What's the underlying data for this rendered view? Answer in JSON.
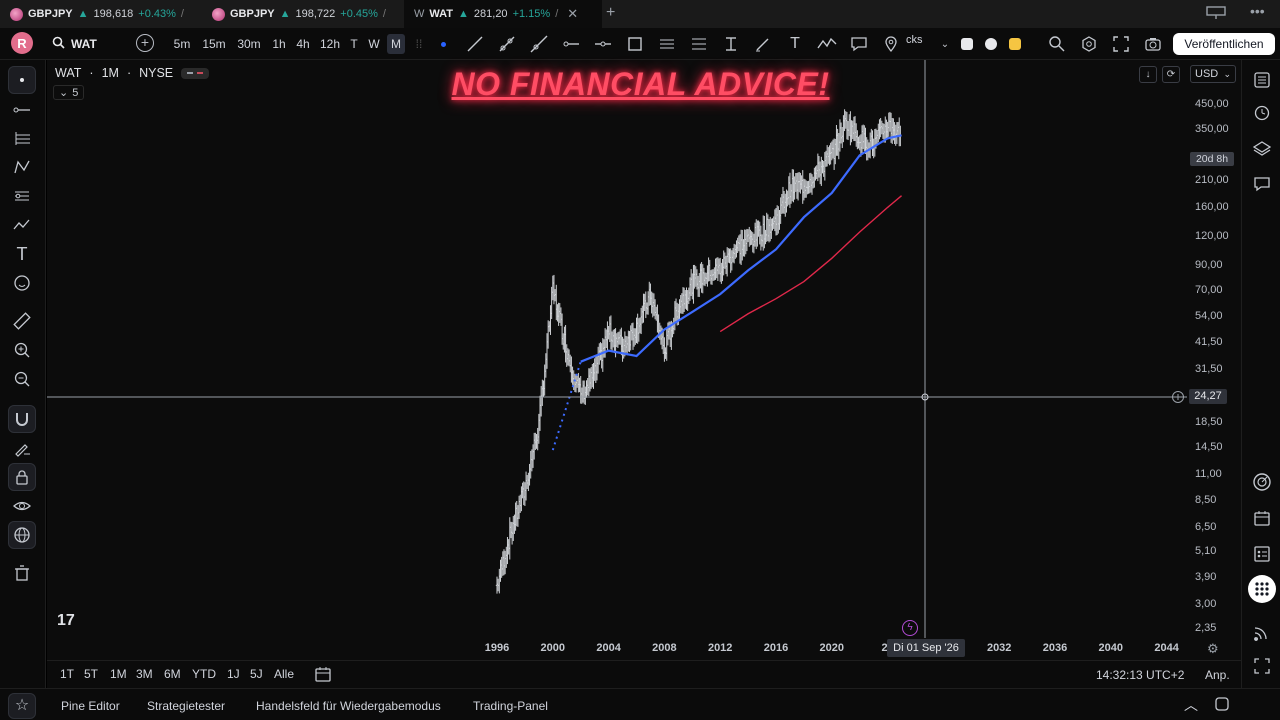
{
  "browser_tabs": [
    {
      "name": "GBPJPY",
      "price": "198,618",
      "change": "+0.43%",
      "tail": "/"
    },
    {
      "name": "GBPJPY",
      "price": "198,722",
      "change": "+0.45%",
      "tail": "/"
    },
    {
      "name": "WAT",
      "favicon_text": "W",
      "price": "281,20",
      "change": "+1.15%",
      "tail": "/"
    }
  ],
  "toolbar": {
    "avatar": "R",
    "symbol": "WAT",
    "intervals": [
      "5m",
      "15m",
      "30m",
      "1h",
      "4h",
      "12h",
      "T",
      "W",
      "M"
    ],
    "active_interval": "M",
    "stocks_text": "cks",
    "publish_label": "Veröffentlichen"
  },
  "legend": {
    "symbol": "WAT",
    "interval": "1M",
    "exchange": "NYSE",
    "indicator_count": "5"
  },
  "headline": "NO FINANCIAL ADVICE!",
  "price_axis": {
    "currency": "USD",
    "labels": [
      "450,00",
      "350,00",
      "210,00",
      "160,00",
      "120,00",
      "90,00",
      "70,00",
      "54,00",
      "41,50",
      "31,50",
      "18,50",
      "14,50",
      "11,00",
      "8,50",
      "6,50",
      "5,10",
      "3,90",
      "3,00",
      "2,35"
    ],
    "countdown": "20d 8h",
    "crosshair_price": "24,27"
  },
  "time_axis": {
    "labels": [
      "1996",
      "2000",
      "2004",
      "2008",
      "2012",
      "2016",
      "2020",
      "20",
      "2032",
      "2036",
      "2040",
      "2044"
    ],
    "crosshair_time": "Di 01 Sep '26"
  },
  "range_bar": {
    "ranges": [
      "1T",
      "5T",
      "1M",
      "3M",
      "6M",
      "YTD",
      "1J",
      "5J",
      "Alle"
    ],
    "clock": "14:32:13 UTC+2",
    "adjust": "Anp."
  },
  "bottom_tabs": [
    "Pine Editor",
    "Strategietester",
    "Handelsfeld für Wiedergabemodus",
    "Trading-Panel"
  ],
  "logo_text": "17",
  "colors": {
    "accent_blue": "#2962ff",
    "sma_blue": "#3d6bff",
    "sma_red": "#e0284a",
    "positive": "#26a69a",
    "headline_glow": "#ff2a49"
  },
  "chart_data": {
    "type": "candlestick",
    "symbol": "WAT",
    "interval": "1M",
    "y_scale": "log",
    "x": [
      1996,
      1997,
      1998,
      1999,
      2000,
      2001,
      2002,
      2003,
      2004,
      2005,
      2006,
      2007,
      2008,
      2009,
      2010,
      2011,
      2012,
      2013,
      2014,
      2015,
      2016,
      2017,
      2018,
      2019,
      2020,
      2021,
      2022,
      2023,
      2024,
      2025
    ],
    "close": [
      3.6,
      6.2,
      9.5,
      18.0,
      70.0,
      38.0,
      24.0,
      30.0,
      46.0,
      40.0,
      48.0,
      66.0,
      38.0,
      60.0,
      74.0,
      82.0,
      86.0,
      104.0,
      115.0,
      125.0,
      140.0,
      195.0,
      200.0,
      230.0,
      270.0,
      380.0,
      320.0,
      300.0,
      370.0,
      330.0
    ],
    "series": [
      {
        "name": "",
        "color": "#3d6bff",
        "x": [
          2000,
          2002,
          2004,
          2006,
          2008,
          2010,
          2012,
          2014,
          2016,
          2018,
          2020,
          2022,
          2024,
          2025
        ],
        "values": [
          14,
          34,
          38,
          36,
          47,
          56,
          67,
          85,
          105,
          145,
          185,
          270,
          320,
          330
        ]
      },
      {
        "name": "",
        "color": "#e0284a",
        "x": [
          2012,
          2014,
          2016,
          2018,
          2020,
          2022,
          2024,
          2025
        ],
        "values": [
          46,
          55,
          64,
          76,
          96,
          125,
          160,
          180
        ]
      }
    ],
    "ylim": [
      2.3,
      520
    ],
    "xlim": [
      1992,
      2046
    ]
  }
}
